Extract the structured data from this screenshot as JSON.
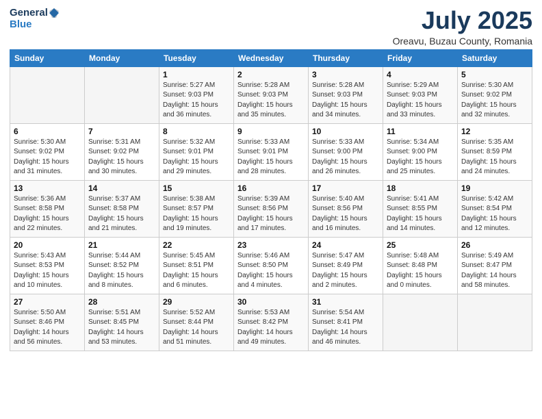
{
  "brand": {
    "general": "General",
    "blue": "Blue"
  },
  "title": "July 2025",
  "location": "Oreavu, Buzau County, Romania",
  "weekdays": [
    "Sunday",
    "Monday",
    "Tuesday",
    "Wednesday",
    "Thursday",
    "Friday",
    "Saturday"
  ],
  "weeks": [
    [
      {
        "day": "",
        "info": ""
      },
      {
        "day": "",
        "info": ""
      },
      {
        "day": "1",
        "info": "Sunrise: 5:27 AM\nSunset: 9:03 PM\nDaylight: 15 hours\nand 36 minutes."
      },
      {
        "day": "2",
        "info": "Sunrise: 5:28 AM\nSunset: 9:03 PM\nDaylight: 15 hours\nand 35 minutes."
      },
      {
        "day": "3",
        "info": "Sunrise: 5:28 AM\nSunset: 9:03 PM\nDaylight: 15 hours\nand 34 minutes."
      },
      {
        "day": "4",
        "info": "Sunrise: 5:29 AM\nSunset: 9:03 PM\nDaylight: 15 hours\nand 33 minutes."
      },
      {
        "day": "5",
        "info": "Sunrise: 5:30 AM\nSunset: 9:02 PM\nDaylight: 15 hours\nand 32 minutes."
      }
    ],
    [
      {
        "day": "6",
        "info": "Sunrise: 5:30 AM\nSunset: 9:02 PM\nDaylight: 15 hours\nand 31 minutes."
      },
      {
        "day": "7",
        "info": "Sunrise: 5:31 AM\nSunset: 9:02 PM\nDaylight: 15 hours\nand 30 minutes."
      },
      {
        "day": "8",
        "info": "Sunrise: 5:32 AM\nSunset: 9:01 PM\nDaylight: 15 hours\nand 29 minutes."
      },
      {
        "day": "9",
        "info": "Sunrise: 5:33 AM\nSunset: 9:01 PM\nDaylight: 15 hours\nand 28 minutes."
      },
      {
        "day": "10",
        "info": "Sunrise: 5:33 AM\nSunset: 9:00 PM\nDaylight: 15 hours\nand 26 minutes."
      },
      {
        "day": "11",
        "info": "Sunrise: 5:34 AM\nSunset: 9:00 PM\nDaylight: 15 hours\nand 25 minutes."
      },
      {
        "day": "12",
        "info": "Sunrise: 5:35 AM\nSunset: 8:59 PM\nDaylight: 15 hours\nand 24 minutes."
      }
    ],
    [
      {
        "day": "13",
        "info": "Sunrise: 5:36 AM\nSunset: 8:58 PM\nDaylight: 15 hours\nand 22 minutes."
      },
      {
        "day": "14",
        "info": "Sunrise: 5:37 AM\nSunset: 8:58 PM\nDaylight: 15 hours\nand 21 minutes."
      },
      {
        "day": "15",
        "info": "Sunrise: 5:38 AM\nSunset: 8:57 PM\nDaylight: 15 hours\nand 19 minutes."
      },
      {
        "day": "16",
        "info": "Sunrise: 5:39 AM\nSunset: 8:56 PM\nDaylight: 15 hours\nand 17 minutes."
      },
      {
        "day": "17",
        "info": "Sunrise: 5:40 AM\nSunset: 8:56 PM\nDaylight: 15 hours\nand 16 minutes."
      },
      {
        "day": "18",
        "info": "Sunrise: 5:41 AM\nSunset: 8:55 PM\nDaylight: 15 hours\nand 14 minutes."
      },
      {
        "day": "19",
        "info": "Sunrise: 5:42 AM\nSunset: 8:54 PM\nDaylight: 15 hours\nand 12 minutes."
      }
    ],
    [
      {
        "day": "20",
        "info": "Sunrise: 5:43 AM\nSunset: 8:53 PM\nDaylight: 15 hours\nand 10 minutes."
      },
      {
        "day": "21",
        "info": "Sunrise: 5:44 AM\nSunset: 8:52 PM\nDaylight: 15 hours\nand 8 minutes."
      },
      {
        "day": "22",
        "info": "Sunrise: 5:45 AM\nSunset: 8:51 PM\nDaylight: 15 hours\nand 6 minutes."
      },
      {
        "day": "23",
        "info": "Sunrise: 5:46 AM\nSunset: 8:50 PM\nDaylight: 15 hours\nand 4 minutes."
      },
      {
        "day": "24",
        "info": "Sunrise: 5:47 AM\nSunset: 8:49 PM\nDaylight: 15 hours\nand 2 minutes."
      },
      {
        "day": "25",
        "info": "Sunrise: 5:48 AM\nSunset: 8:48 PM\nDaylight: 15 hours\nand 0 minutes."
      },
      {
        "day": "26",
        "info": "Sunrise: 5:49 AM\nSunset: 8:47 PM\nDaylight: 14 hours\nand 58 minutes."
      }
    ],
    [
      {
        "day": "27",
        "info": "Sunrise: 5:50 AM\nSunset: 8:46 PM\nDaylight: 14 hours\nand 56 minutes."
      },
      {
        "day": "28",
        "info": "Sunrise: 5:51 AM\nSunset: 8:45 PM\nDaylight: 14 hours\nand 53 minutes."
      },
      {
        "day": "29",
        "info": "Sunrise: 5:52 AM\nSunset: 8:44 PM\nDaylight: 14 hours\nand 51 minutes."
      },
      {
        "day": "30",
        "info": "Sunrise: 5:53 AM\nSunset: 8:42 PM\nDaylight: 14 hours\nand 49 minutes."
      },
      {
        "day": "31",
        "info": "Sunrise: 5:54 AM\nSunset: 8:41 PM\nDaylight: 14 hours\nand 46 minutes."
      },
      {
        "day": "",
        "info": ""
      },
      {
        "day": "",
        "info": ""
      }
    ]
  ]
}
